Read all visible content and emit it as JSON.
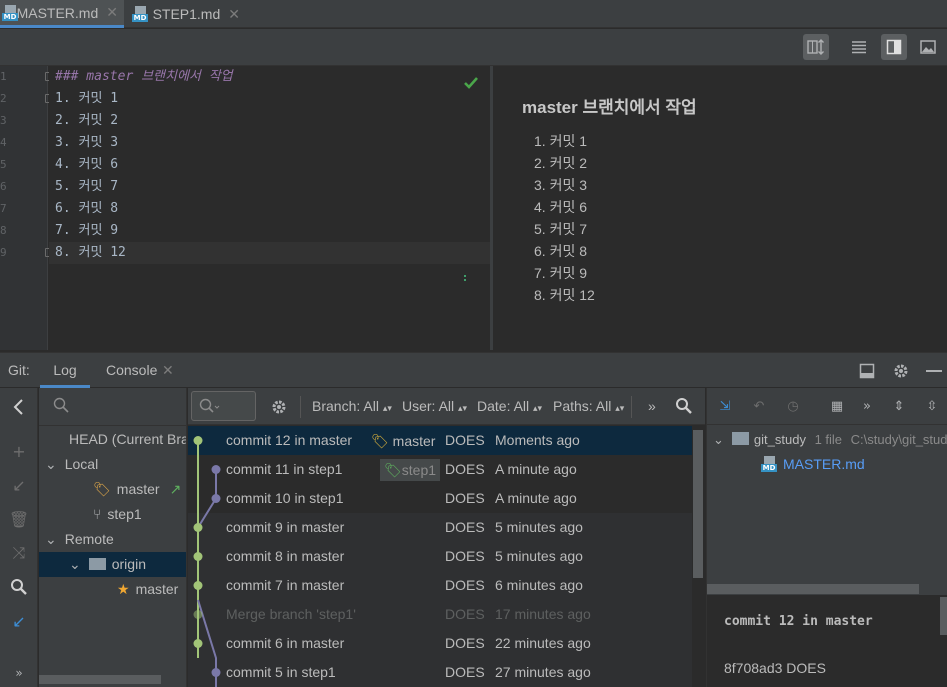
{
  "tabs": [
    {
      "label": "MASTER.md",
      "icon": "markdown-file-icon",
      "icon_text": "MD"
    },
    {
      "label": "STEP1.md",
      "icon": "markdown-file-icon",
      "icon_text": "MD"
    }
  ],
  "editor": {
    "line_numbers": [
      "1",
      "2",
      "3",
      "4",
      "5",
      "6",
      "7",
      "8",
      "9"
    ],
    "lines": [
      "### master 브랜치에서 작업",
      "1. 커밋 1",
      "2. 커밋 2",
      "3. 커밋 3",
      "4. 커밋 6",
      "5. 커밋 7",
      "6. 커밋 8",
      "7. 커밋 9",
      "8. 커밋 12"
    ]
  },
  "preview": {
    "heading": "master 브랜치에서 작업",
    "items": [
      "1. 커밋 1",
      "2. 커밋 2",
      "3. 커밋 3",
      "4. 커밋 6",
      "5. 커밋 7",
      "6. 커밋 8",
      "7. 커밋 9",
      "8. 커밋 12"
    ]
  },
  "toolwindow": {
    "title": "Git:",
    "tabs": [
      "Log",
      "Console"
    ]
  },
  "branches": {
    "head": "HEAD (Current Branch)",
    "local_label": "Local",
    "local": [
      "master",
      "step1"
    ],
    "remote_label": "Remote",
    "remote_folder": "origin",
    "remote_branches": [
      "master"
    ]
  },
  "log_filters": {
    "branch": "Branch: All",
    "user": "User: All",
    "date": "Date: All",
    "paths": "Paths: All"
  },
  "commits": [
    {
      "message": "commit 12 in master",
      "ref": "master",
      "author": "DOES",
      "date": "Moments ago"
    },
    {
      "message": "commit 11 in step1",
      "ref": "step1",
      "author": "DOES",
      "date": "A minute ago"
    },
    {
      "message": "commit 10 in step1",
      "ref": "",
      "author": "DOES",
      "date": "A minute ago"
    },
    {
      "message": "commit 9 in master",
      "ref": "",
      "author": "DOES",
      "date": "5 minutes ago"
    },
    {
      "message": "commit 8 in master",
      "ref": "",
      "author": "DOES",
      "date": "5 minutes ago"
    },
    {
      "message": "commit 7 in master",
      "ref": "",
      "author": "DOES",
      "date": "6 minutes ago"
    },
    {
      "message": "Merge branch 'step1'",
      "ref": "",
      "author": "DOES",
      "date": "17 minutes ago"
    },
    {
      "message": "commit 6 in master",
      "ref": "",
      "author": "DOES",
      "date": "22 minutes ago"
    },
    {
      "message": "commit 5 in step1",
      "ref": "",
      "author": "DOES",
      "date": "27 minutes ago"
    }
  ],
  "details": {
    "repo": "git_study",
    "file_count": "1 file",
    "path": "C:\\study\\git_study",
    "file": "MASTER.md",
    "commit_title": "commit 12 in master",
    "hash_author": "8f708ad3 DOES"
  },
  "colors": {
    "accent": "#4a88c7",
    "graph_master": "#a2c478",
    "graph_step1": "#7a78a8",
    "selection": "#0d293e",
    "link": "#589df6"
  }
}
